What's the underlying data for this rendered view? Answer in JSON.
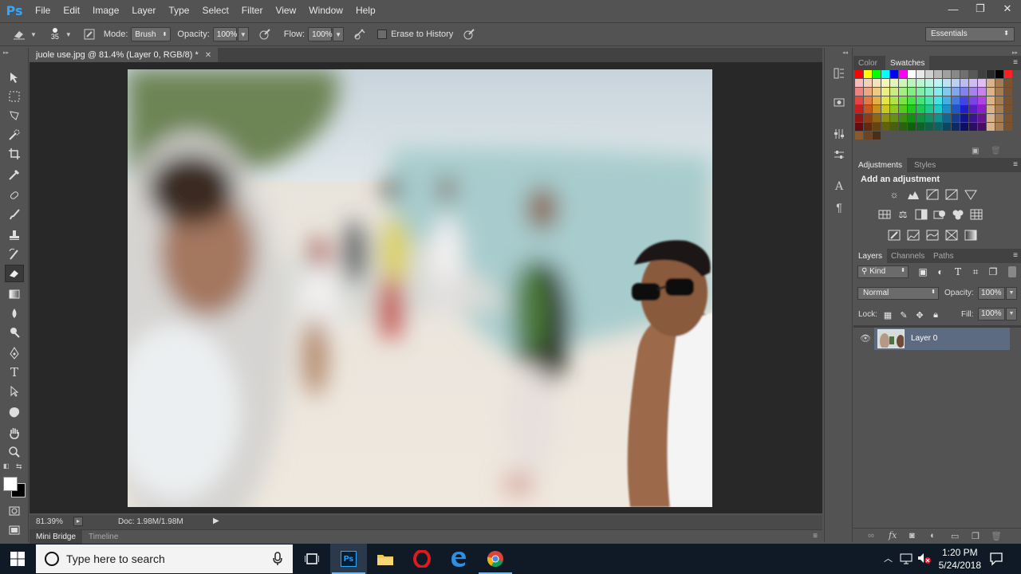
{
  "app": {
    "logo": "Ps",
    "menu": [
      "File",
      "Edit",
      "Image",
      "Layer",
      "Type",
      "Select",
      "Filter",
      "View",
      "Window",
      "Help"
    ],
    "window_controls": {
      "minimize": "—",
      "restore": "❐",
      "close": "✕"
    }
  },
  "options": {
    "brush_size": "35",
    "mode_label": "Mode:",
    "mode_value": "Brush",
    "opacity_label": "Opacity:",
    "opacity_value": "100%",
    "flow_label": "Flow:",
    "flow_value": "100%",
    "erase_history_label": "Erase to History",
    "workspace": "Essentials"
  },
  "document": {
    "tab_title": "juole use.jpg @ 81.4% (Layer 0, RGB/8) *",
    "zoom": "81.39%",
    "doc_size": "Doc: 1.98M/1.98M"
  },
  "bottom_tabs": [
    "Mini Bridge",
    "Timeline"
  ],
  "panels": {
    "color_tabs": [
      "Color",
      "Swatches"
    ],
    "active_color_tab": "Swatches",
    "adjust_tabs": [
      "Adjustments",
      "Styles"
    ],
    "add_adjustment": "Add an adjustment",
    "layers_tabs": [
      "Layers",
      "Channels",
      "Paths"
    ],
    "filter_kind": "Kind",
    "blend_mode": "Normal",
    "opacity_label": "Opacity:",
    "opacity_value": "100%",
    "lock_label": "Lock:",
    "fill_label": "Fill:",
    "fill_value": "100%",
    "layer_name": "Layer 0"
  },
  "taskbar": {
    "search_placeholder": "Type here to search",
    "time": "1:20 PM",
    "date": "5/24/2018"
  },
  "colors": {
    "accent": "#31a8ff",
    "panel_bg": "#535353",
    "canvas_bg": "#282828",
    "taskbar_bg": "#0f1a26",
    "selected_layer": "#5c6b82"
  }
}
